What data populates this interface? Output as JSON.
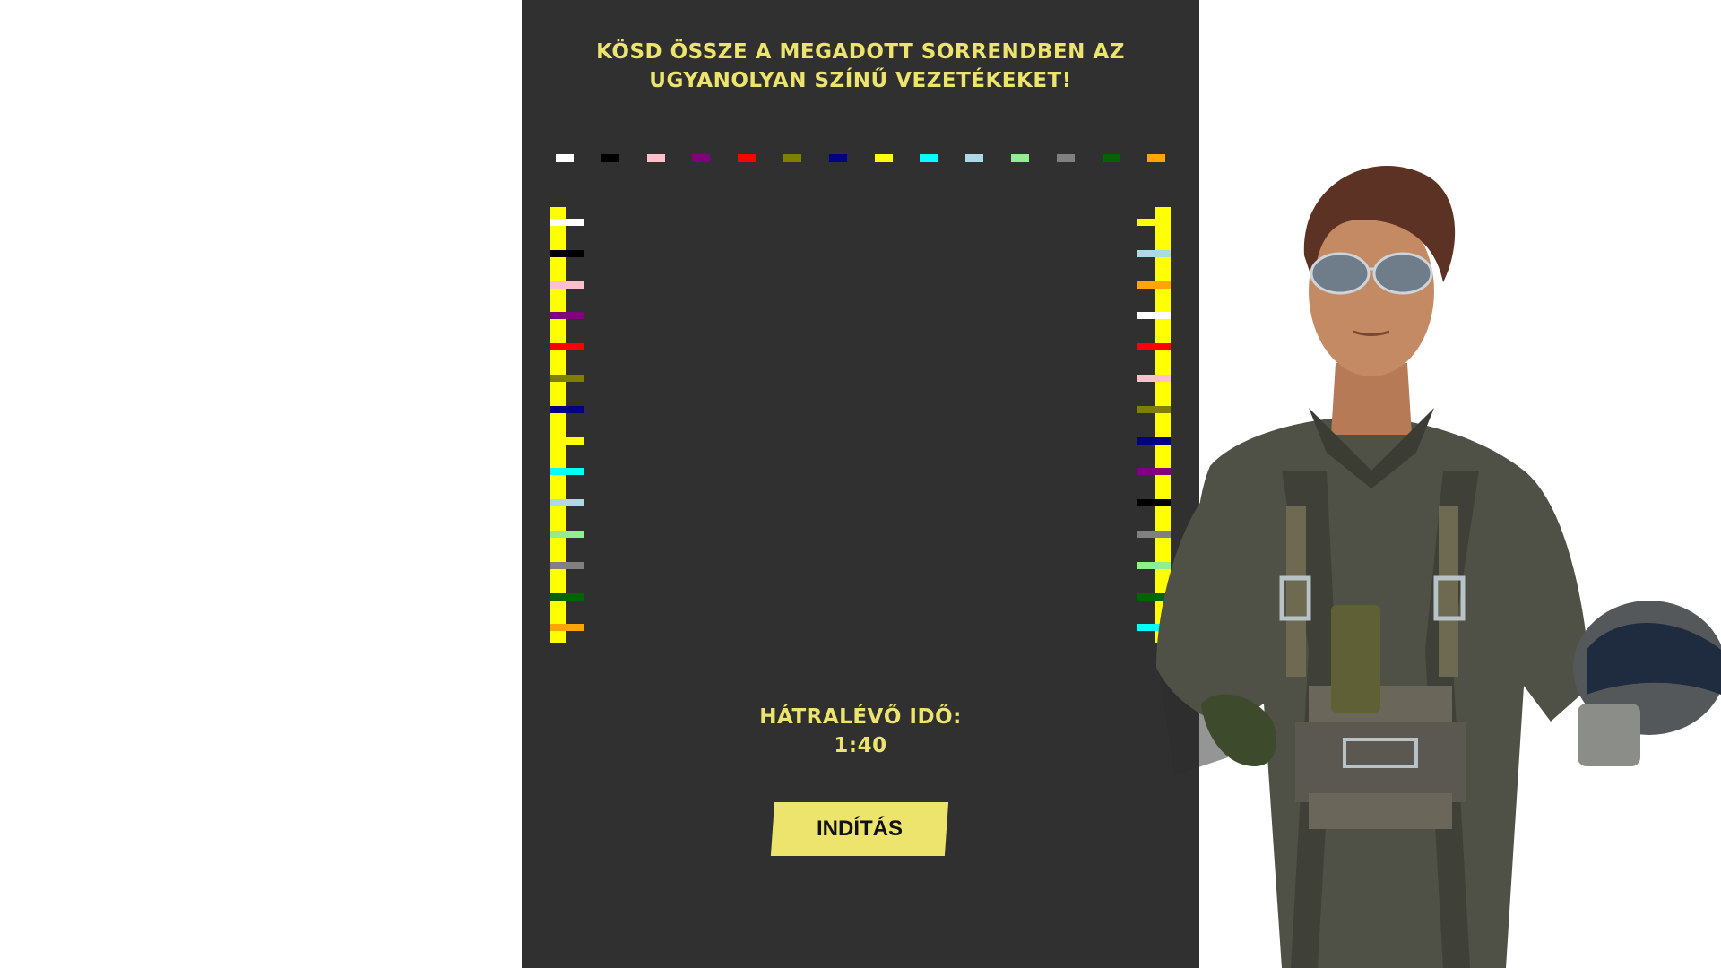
{
  "title_lines": [
    "KÖSD ÖSSZE A MEGADOTT SORRENDBEN AZ",
    "UGYANOLYAN SZÍNŰ VEZETÉKEKET!"
  ],
  "colors": {
    "panel_bg": "#303030",
    "accent_text": "#ece46c",
    "bar": "#ffff00",
    "button_bg": "#ece46c"
  },
  "order_sequence": [
    "#ffffff",
    "#000000",
    "#ffc0cb",
    "#800080",
    "#ff0000",
    "#808000",
    "#000080",
    "#ffff00",
    "#00ffff",
    "#add8e6",
    "#90ee90",
    "#808080",
    "#006400",
    "#ffa500"
  ],
  "left_wires": [
    "#ffffff",
    "#000000",
    "#ffc0cb",
    "#800080",
    "#ff0000",
    "#808000",
    "#000080",
    "#ffff00",
    "#00ffff",
    "#add8e6",
    "#90ee90",
    "#808080",
    "#006400",
    "#ffa500"
  ],
  "right_wires": [
    "#ffff00",
    "#add8e6",
    "#ffa500",
    "#ffffff",
    "#ff0000",
    "#ffc0cb",
    "#808000",
    "#000080",
    "#800080",
    "#000000",
    "#808080",
    "#90ee90",
    "#006400",
    "#00ffff"
  ],
  "timer": {
    "label": "HÁTRALÉVŐ IDŐ:",
    "value": "1:40"
  },
  "start_button_label": "INDÍTÁS",
  "illustration": "pilot-character-icon"
}
